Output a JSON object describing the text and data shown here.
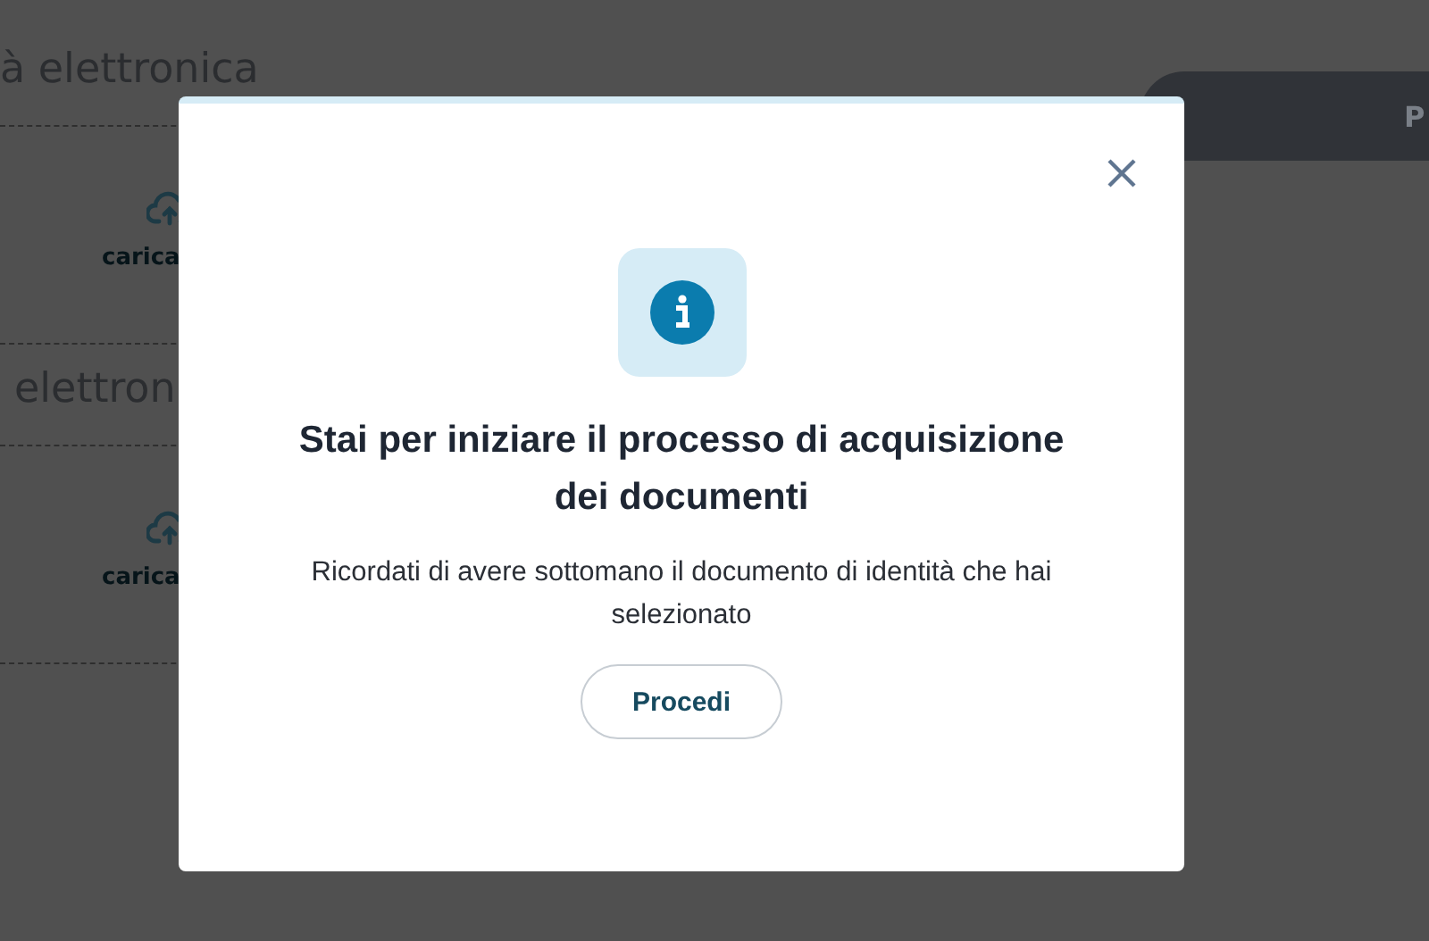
{
  "background": {
    "sections": [
      {
        "heading": "à elettronica",
        "upload_label": "carica"
      },
      {
        "heading": "elettron",
        "upload_label": "carica"
      }
    ],
    "pill_button": "P"
  },
  "dialog": {
    "title": "Stai per iniziare il processo di acquisizione dei documenti",
    "message": "Ricordati di avere sottomano il documento di identità che hai selezionato",
    "button": "Procedi"
  }
}
